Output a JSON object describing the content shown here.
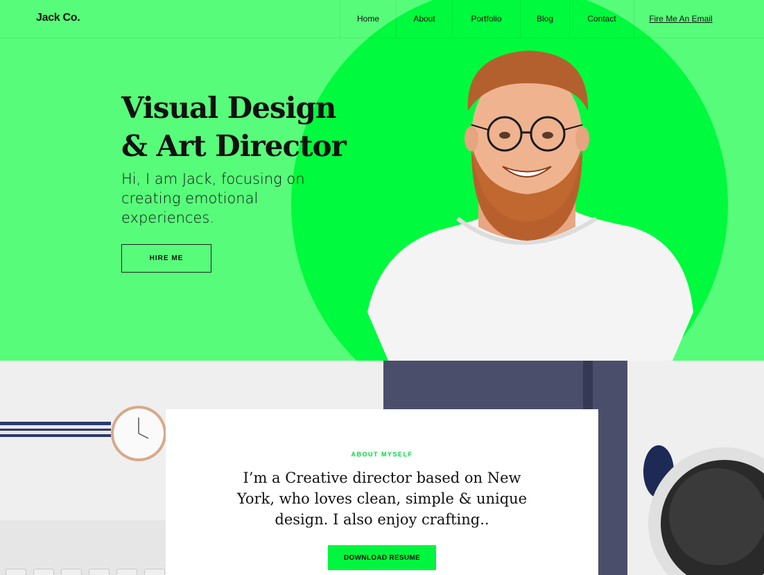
{
  "header": {
    "logo": "Jack Co.",
    "nav": [
      "Home",
      "About",
      "Portfolio",
      "Blog",
      "Contact"
    ],
    "email_link": "Fire Me An Email"
  },
  "hero": {
    "title_line1": "Visual Design",
    "title_line2": "& Art Director",
    "subtitle": "Hi, I am Jack, focusing on creating emotional experiences.",
    "cta": "HIRE ME"
  },
  "about": {
    "tag": "ABOUT MYSELF",
    "text": "I’m a Creative director based on New York, who loves clean, simple & unique design. I also enjoy crafting..",
    "cta": "DOWNLOAD RESUME"
  },
  "colors": {
    "hero_bg": "#57fd7a",
    "accent": "#00fa3d"
  }
}
